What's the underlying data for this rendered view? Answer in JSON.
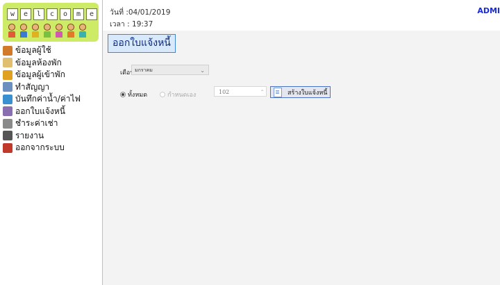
{
  "logo": {
    "letters": [
      "w",
      "e",
      "l",
      "c",
      "o",
      "m",
      "e"
    ],
    "background_color": "#cdeb66"
  },
  "sidebar": {
    "items": [
      {
        "label": "ข้อมูลผู้ใช้",
        "icon": "users-icon",
        "color": "#d07a2a"
      },
      {
        "label": "ข้อมูลห้องพัก",
        "icon": "room-icon",
        "color": "#e0c070"
      },
      {
        "label": "ข้อมูลผู้เข้าพัก",
        "icon": "tenant-icon",
        "color": "#e0a020"
      },
      {
        "label": "ทำสัญญา",
        "icon": "contract-icon",
        "color": "#6b8fbf"
      },
      {
        "label": "บันทึกค่าน้ำ/ค่าไฟ",
        "icon": "meter-icon",
        "color": "#3a8fd0"
      },
      {
        "label": "ออกใบแจ้งหนี้",
        "icon": "invoice-icon",
        "color": "#8a6fb0"
      },
      {
        "label": "ชำระค่าเช่า",
        "icon": "payment-icon",
        "color": "#8a8a8a"
      },
      {
        "label": "รายงาน",
        "icon": "report-icon",
        "color": "#555555"
      },
      {
        "label": "ออกจากระบบ",
        "icon": "logout-icon",
        "color": "#c0392b"
      }
    ]
  },
  "header": {
    "date_text": "วันที่ :04/01/2019",
    "time_text": "เวลา : 19:37",
    "user_text": "ADMI"
  },
  "main": {
    "page_title": "ออกใบแจ้งหนี้",
    "month_label": "เดือน",
    "month_value": "มกราคม",
    "radio_all_label": "ทั้งหมด",
    "radio_custom_label": "กำหนดเอง",
    "room_number_value": "102",
    "create_button_label": "สร้างใบแจ้งหนี้"
  },
  "colors": {
    "accent": "#3d86d4",
    "admin_text": "#1a2bd6",
    "content_bg": "#f3f3f3"
  }
}
